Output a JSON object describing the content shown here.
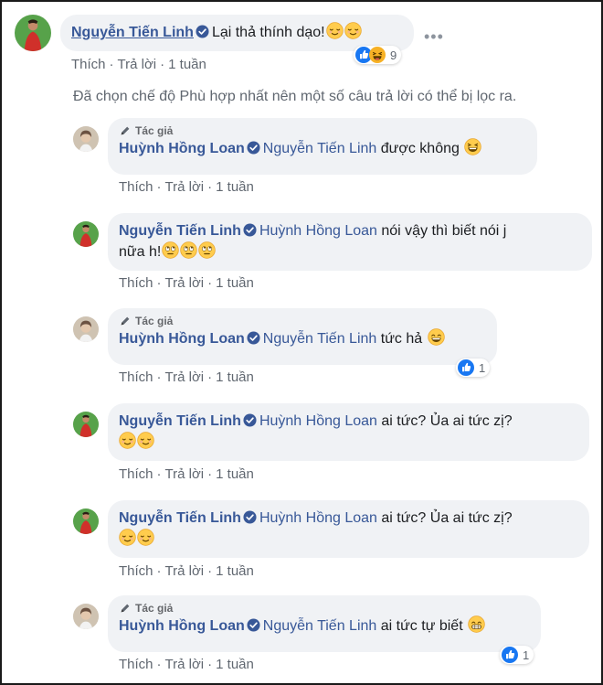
{
  "colors": {
    "name": "#385898",
    "meta": "#606770",
    "bubble": "#f0f2f5",
    "like_blue": "#1877f2",
    "laugh_yellow": "#f7b125"
  },
  "actions": {
    "like": "Thích",
    "reply": "Trả lời",
    "time": "1 tuần"
  },
  "author_tag": "Tác giả",
  "filter_note": "Đã chọn chế độ Phù hợp nhất nên một số câu trả lời có thể bị lọc ra.",
  "comments": [
    {
      "author": "Nguyễn Tiến Linh",
      "text": "Lại thả thính dạo!",
      "emojis": [
        "relieved-emoji",
        "relieved-emoji"
      ],
      "reactions": {
        "icons": [
          "like-icon",
          "haha-icon"
        ],
        "count": "9"
      }
    },
    {
      "author": "Huỳnh Hồng Loan",
      "mention": "Nguyễn Tiến Linh",
      "text": "được không",
      "emojis": [
        "laughing-emoji"
      ]
    },
    {
      "author": "Nguyễn Tiến Linh",
      "mention": "Huỳnh Hồng Loan",
      "text_line1": "nói vậy thì biết nói j",
      "text_line2": "nữa h!",
      "emojis": [
        "rolling-eyes-emoji",
        "rolling-eyes-emoji",
        "rolling-eyes-emoji"
      ]
    },
    {
      "author": "Huỳnh Hồng Loan",
      "mention": "Nguyễn Tiến Linh",
      "text": "tức hả",
      "emojis": [
        "grinning-emoji"
      ],
      "reactions": {
        "icons": [
          "like-icon"
        ],
        "count": "1"
      }
    },
    {
      "author": "Nguyễn Tiến Linh",
      "mention": "Huỳnh Hồng Loan",
      "text": "ai tức? Ủa ai tức zị?",
      "emojis": [
        "relieved-emoji",
        "relieved-emoji"
      ]
    },
    {
      "author": "Nguyễn Tiến Linh",
      "mention": "Huỳnh Hồng Loan",
      "text": "ai tức? Ủa ai tức zị?",
      "emojis": [
        "relieved-emoji",
        "relieved-emoji"
      ]
    },
    {
      "author": "Huỳnh Hồng Loan",
      "mention": "Nguyễn Tiến Linh",
      "text": "ai tức tự biết",
      "emojis": [
        "beaming-emoji"
      ],
      "reactions": {
        "icons": [
          "like-icon"
        ],
        "count": "1"
      }
    }
  ]
}
